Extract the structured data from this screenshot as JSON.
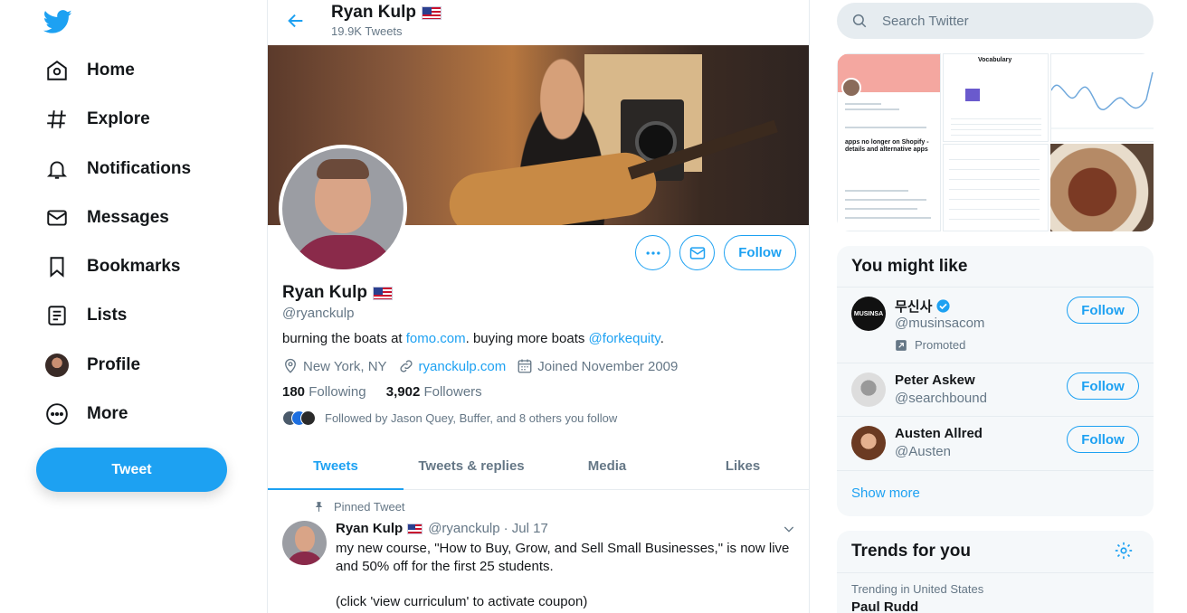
{
  "nav": {
    "items": [
      {
        "label": "Home",
        "icon": "home-icon"
      },
      {
        "label": "Explore",
        "icon": "hashtag-icon"
      },
      {
        "label": "Notifications",
        "icon": "bell-icon"
      },
      {
        "label": "Messages",
        "icon": "envelope-icon"
      },
      {
        "label": "Bookmarks",
        "icon": "bookmark-icon"
      },
      {
        "label": "Lists",
        "icon": "list-icon"
      },
      {
        "label": "Profile",
        "icon": "avatar"
      },
      {
        "label": "More",
        "icon": "more-circle-icon"
      }
    ],
    "tweet_button": "Tweet"
  },
  "header": {
    "name": "Ryan Kulp",
    "tweet_count": "19.9K Tweets"
  },
  "profile": {
    "name": "Ryan Kulp",
    "handle": "@ryanckulp",
    "bio_prefix": "burning the boats at ",
    "bio_link1": "fomo.com",
    "bio_middle": ". buying more boats ",
    "bio_link2": "@forkequity",
    "bio_suffix": ".",
    "location": "New York, NY",
    "website": "ryanckulp.com",
    "joined": "Joined November 2009",
    "following_count": "180",
    "following_label": "Following",
    "followers_count": "3,902",
    "followers_label": "Followers",
    "followed_by": "Followed by Jason Quey, Buffer, and 8 others you follow",
    "follow_button": "Follow"
  },
  "tabs": [
    "Tweets",
    "Tweets & replies",
    "Media",
    "Likes"
  ],
  "pinned_tweet": {
    "pinned_label": "Pinned Tweet",
    "name": "Ryan Kulp",
    "handle": "@ryanckulp",
    "date": "· Jul 17",
    "text": "my new course, \"How to Buy, Grow, and Sell Small Businesses,\" is now live and 50% off for the first 25 students.\n\n(click 'view curriculum' to activate coupon)"
  },
  "search": {
    "placeholder": "Search Twitter"
  },
  "media_grid": {
    "tile1_headline": "apps no longer on Shopify - details and alternative apps",
    "tile2_title": "Vocabulary"
  },
  "who_to_follow": {
    "title": "You might like",
    "items": [
      {
        "name": "무신사",
        "handle": "@musinsacom",
        "verified": true,
        "promoted": "Promoted",
        "avatar_text": "MUSINSA",
        "button": "Follow"
      },
      {
        "name": "Peter Askew",
        "handle": "@searchbound",
        "button": "Follow"
      },
      {
        "name": "Austen Allred",
        "handle": "@Austen",
        "button": "Follow"
      }
    ],
    "show_more": "Show more"
  },
  "trends": {
    "title": "Trends for you",
    "items": [
      {
        "context": "Trending in United States",
        "name": "Paul Rudd"
      }
    ]
  },
  "colors": {
    "accent": "#1da1f2",
    "text": "#14171a",
    "muted": "#657786"
  }
}
